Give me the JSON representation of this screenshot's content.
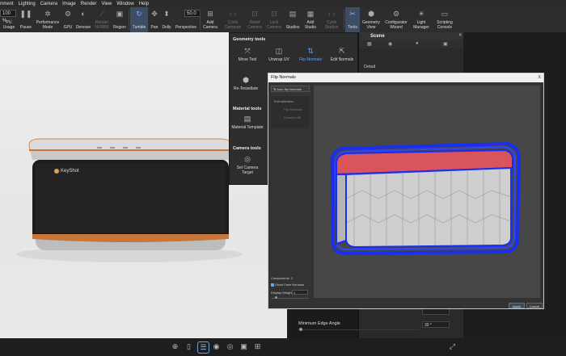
{
  "menubar": [
    "nment",
    "Lighting",
    "Camera",
    "Image",
    "Render",
    "View",
    "Window",
    "Help"
  ],
  "toolbar": {
    "zoom_value": "100 %",
    "cpu_label": "PU Usage",
    "pause_label": "Pause",
    "performance_label": "Performance Mode",
    "gpu_label": "GPU",
    "denoise_label": "Denoise",
    "render_nurbs_label": "Render NURBS",
    "region_label": "Region",
    "tumble_label": "Tumble",
    "pan_label": "Pan",
    "dolly_label": "Dolly",
    "perspective_value": "50.0",
    "perspective_label": "Perspective",
    "add_camera_label": "Add Camera",
    "cycle_cameras_label": "Cycle Cameras",
    "reset_camera_label": "Reset Camera",
    "lock_camera_label": "Lock Camera",
    "studios_label": "Studios",
    "add_studio_label": "Add Studio",
    "cycle_studios_label": "Cycle Studios",
    "tools_label": "Tools",
    "geometry_view_label": "Geometry View",
    "configurator_wizard_label": "Configurator Wizard",
    "light_manager_label": "Light Manager",
    "scripting_console_label": "Scripting Console"
  },
  "viewport": {
    "brand": "KeyShot"
  },
  "geometry_panel": {
    "section1_title": "Geometry tools",
    "move_tool": "Move Tool",
    "unwrap_uv": "Unwrap UV",
    "flip_normals": "Flip Normals",
    "edit_normals": "Edit Normals",
    "retessellate": "Re-Tessellate",
    "section2_title": "Material tools",
    "material_template": "Material Template",
    "section3_title": "Camera tools",
    "set_camera_target": "Set Camera Target"
  },
  "scene_panel": {
    "title": "Scene",
    "detail_label": "Detail",
    "min_edge_angle_label": "Minimum Edge Angle",
    "min_edge_angle_value": "30 °"
  },
  "dialog": {
    "title": "Flip Normals",
    "auto_flip_label": "Auto flip Normals",
    "sidebar_item1": "Edit selection",
    "sidebar_item2": "Flip Normals",
    "sidebar_item3": "Deselect All",
    "components_label": "Components: 2",
    "show_face_normals": "Show Face Normals",
    "display_weight_label": "Display Weight",
    "display_weight_value": "1",
    "apply_label": "Apply",
    "cancel_label": "Cancel",
    "close_label": "X"
  }
}
